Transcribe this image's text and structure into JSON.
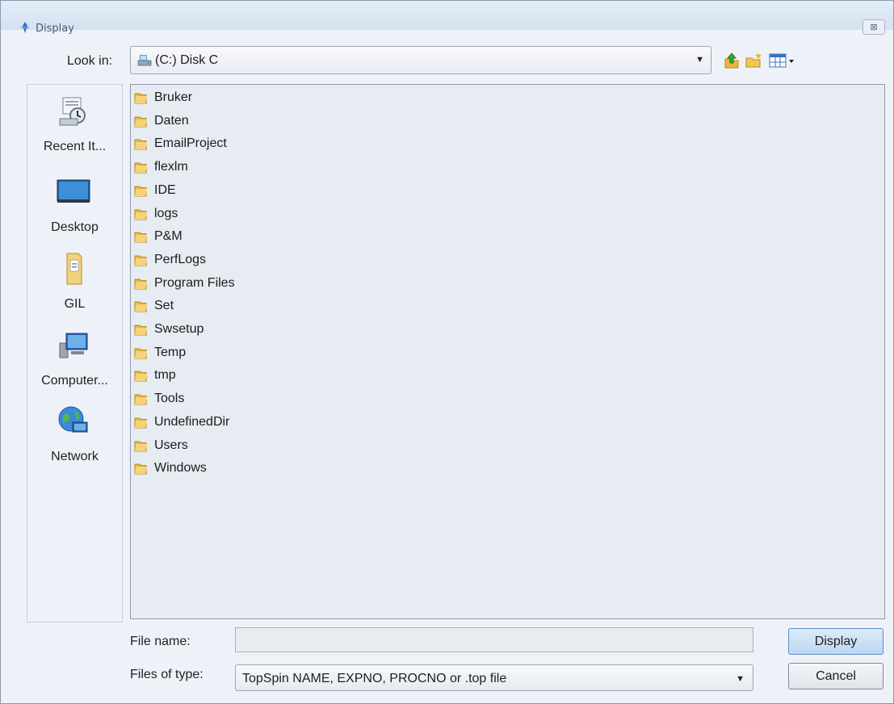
{
  "window": {
    "title": "Display",
    "close_glyph": "⊠",
    "app_icon": "topspin-icon"
  },
  "lookin": {
    "label": "Look in:",
    "value": "(C:) Disk C",
    "icon": "drive-icon"
  },
  "toolbar": {
    "up_icon": "up-folder-icon",
    "new_folder_icon": "new-folder-icon",
    "view_icon": "view-menu-icon"
  },
  "places": [
    {
      "label": "Recent It...",
      "icon": "recent-items-icon"
    },
    {
      "label": "Desktop",
      "icon": "desktop-icon"
    },
    {
      "label": "GIL",
      "icon": "user-folder-icon"
    },
    {
      "label": "Computer...",
      "icon": "computer-icon"
    },
    {
      "label": "Network",
      "icon": "network-icon"
    }
  ],
  "files": [
    "Bruker",
    "Daten",
    "EmailProject",
    "flexlm",
    "IDE",
    "logs",
    "P&M",
    "PerfLogs",
    "Program Files",
    "Set",
    "Swsetup",
    "Temp",
    "tmp",
    "Tools",
    "UndefinedDir",
    "Users",
    "Windows"
  ],
  "filename": {
    "label": "File name:",
    "value": ""
  },
  "filetype": {
    "label": "Files of type:",
    "value": "TopSpin NAME, EXPNO, PROCNO or .top file"
  },
  "buttons": {
    "display": "Display",
    "cancel": "Cancel"
  },
  "colors": {
    "accent": "#5f8fc6",
    "folder": "#e9b83a",
    "panel": "#e7ecf3"
  }
}
